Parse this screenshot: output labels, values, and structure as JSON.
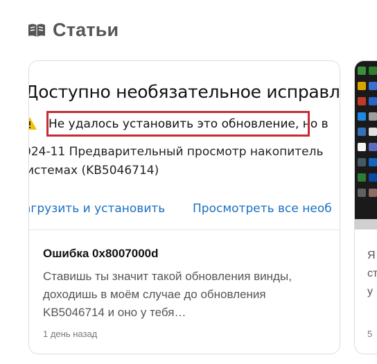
{
  "section": {
    "icon": "open-book-icon",
    "title": "Статьи"
  },
  "colors": {
    "accent_link": "#1a6fc1",
    "error_box": "#c42b33",
    "warning": "#f2c200"
  },
  "cards": [
    {
      "thumbnail": {
        "heading": "Доступно необязательное исправлени",
        "warning_icon": "warning-triangle-icon",
        "error": "Не удалось установить это обновление, но в",
        "line1": "024-11 Предварительный просмотр накопитель",
        "line2": "истемах (KB5046714)",
        "link_download": "агрузить и установить",
        "link_view_all": "Просмотреть все необ"
      },
      "title": "Ошибка 0x8007000d",
      "excerpt": "Ставишь ты значит такой обновления винды, доходишь в моём случае до обновления KB5046714 и оно у тебя…",
      "time": "1 день назад"
    },
    {
      "text_line1": "Я",
      "text_line2": "ст",
      "text_line3": "у",
      "time": "5"
    }
  ]
}
